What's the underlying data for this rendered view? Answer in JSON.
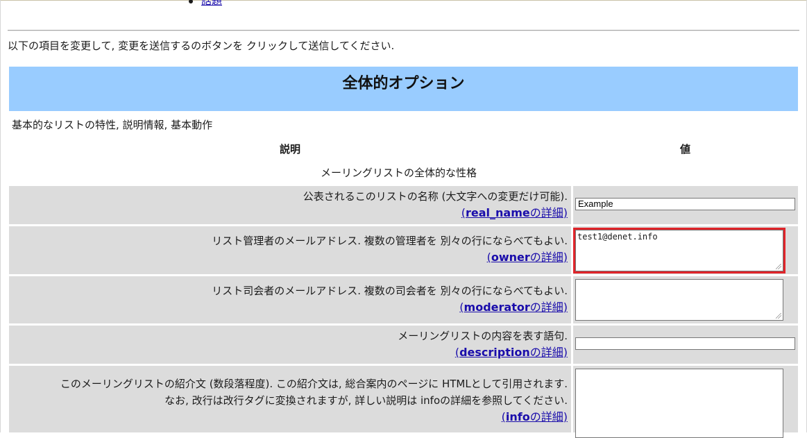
{
  "top_nav": {
    "link_label": "話題"
  },
  "instruction": "以下の項目を変更して, 変更を送信するのボタンを クリックして送信してください.",
  "section": {
    "title": "全体的オプション",
    "description": "基本的なリストの特性, 説明情報, 基本動作"
  },
  "table": {
    "col_description": "説明",
    "col_value": "値",
    "group_title": "メーリングリストの全体的な性格",
    "rows": [
      {
        "desc_line1": "公表されるこのリストの名称 (大文字への変更だけ可能).",
        "link_option": "real_name",
        "link_suffix": "の詳細",
        "value": "Example"
      },
      {
        "desc_line1": "リスト管理者のメールアドレス. 複数の管理者を 別々の行にならべてもよい.",
        "link_option": "owner",
        "link_suffix": "の詳細",
        "value": "test1@denet.info"
      },
      {
        "desc_line1": "リスト司会者のメールアドレス. 複数の司会者を 別々の行にならべてもよい.",
        "link_option": "moderator",
        "link_suffix": "の詳細",
        "value": ""
      },
      {
        "desc_line1": "メーリングリストの内容を表す語句.",
        "link_option": "description",
        "link_suffix": "の詳細",
        "value": ""
      },
      {
        "desc_line1": "このメーリングリストの紹介文 (数段落程度). この紹介文は, 総合案内のページに HTMLとして引用されます.",
        "desc_line2": "なお, 改行は改行タグに変換されますが, 詳しい説明は infoの詳細を参照してください.",
        "link_option": "info",
        "link_suffix": "の詳細",
        "value": ""
      }
    ]
  },
  "colors": {
    "section_banner": "#99ccff",
    "row_background": "#dcdcdc",
    "link": "#1a0dab",
    "highlight": "#e0242a"
  }
}
